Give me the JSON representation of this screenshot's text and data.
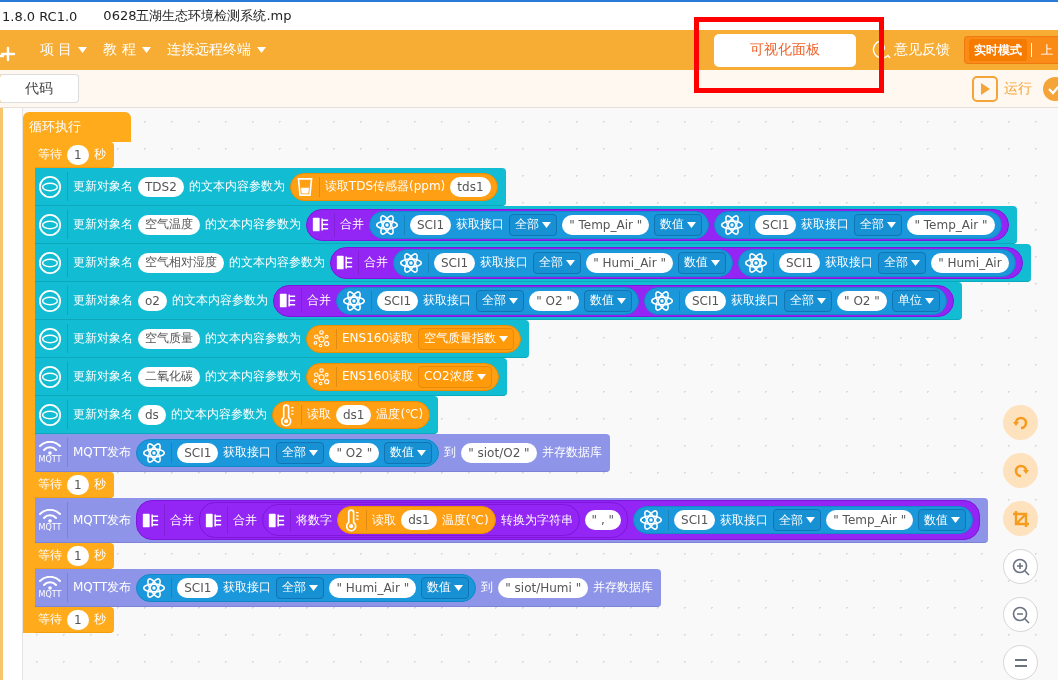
{
  "window": {
    "version": "1.8.0 RC1.0",
    "file": "0628五湖生态环境检测系统.mp"
  },
  "menu": [
    {
      "label": "项 目"
    },
    {
      "label": "教 程"
    },
    {
      "label": "连接远程终端"
    }
  ],
  "panel_button": "可视化面板",
  "feedback": "意见反馈",
  "mode_switch": [
    {
      "label": "实时模式",
      "selected": true
    },
    {
      "label": "上",
      "selected": false
    }
  ],
  "code_tab": "代码",
  "run_button": "运行",
  "program": {
    "hat": "循环执行",
    "statements": [
      {
        "kind": "wait",
        "parts": [
          {
            "kind": "text",
            "text": "等待"
          },
          {
            "kind": "field",
            "text": "1"
          },
          {
            "kind": "text",
            "text": "秒"
          }
        ]
      },
      {
        "kind": "update",
        "parts": [
          {
            "kind": "text",
            "text": "更新对象名"
          },
          {
            "kind": "field",
            "text": "TDS2"
          },
          {
            "kind": "text",
            "text": "的文本内容参数为"
          },
          {
            "kind": "tds",
            "parts": [
              {
                "kind": "text",
                "text": "读取TDS传感器(ppm)"
              },
              {
                "kind": "field",
                "text": "tds1"
              }
            ]
          }
        ]
      },
      {
        "kind": "update",
        "parts": [
          {
            "kind": "text",
            "text": "更新对象名"
          },
          {
            "kind": "field",
            "text": "空气温度"
          },
          {
            "kind": "text",
            "text": "的文本内容参数为"
          },
          {
            "kind": "string",
            "parts": [
              {
                "kind": "text",
                "text": "合并"
              },
              {
                "kind": "sci",
                "parts": [
                  {
                    "kind": "field",
                    "text": "SCI1"
                  },
                  {
                    "kind": "text",
                    "text": "获取接口"
                  },
                  {
                    "kind": "dropdown",
                    "text": "全部"
                  },
                  {
                    "kind": "field",
                    "text": "\" Temp_Air \""
                  },
                  {
                    "kind": "dropdown",
                    "text": "数值"
                  }
                ]
              },
              {
                "kind": "sci",
                "parts": [
                  {
                    "kind": "field",
                    "text": "SCI1"
                  },
                  {
                    "kind": "text",
                    "text": "获取接口"
                  },
                  {
                    "kind": "dropdown",
                    "text": "全部"
                  },
                  {
                    "kind": "field",
                    "text": "\" Temp_Air \""
                  }
                ]
              }
            ]
          }
        ]
      },
      {
        "kind": "update",
        "parts": [
          {
            "kind": "text",
            "text": "更新对象名"
          },
          {
            "kind": "field",
            "text": "空气相对湿度"
          },
          {
            "kind": "text",
            "text": "的文本内容参数为"
          },
          {
            "kind": "string",
            "parts": [
              {
                "kind": "text",
                "text": "合并"
              },
              {
                "kind": "sci",
                "parts": [
                  {
                    "kind": "field",
                    "text": "SCI1"
                  },
                  {
                    "kind": "text",
                    "text": "获取接口"
                  },
                  {
                    "kind": "dropdown",
                    "text": "全部"
                  },
                  {
                    "kind": "field",
                    "text": "\" Humi_Air \""
                  },
                  {
                    "kind": "dropdown",
                    "text": "数值"
                  }
                ]
              },
              {
                "kind": "sci",
                "parts": [
                  {
                    "kind": "field",
                    "text": "SCI1"
                  },
                  {
                    "kind": "text",
                    "text": "获取接口"
                  },
                  {
                    "kind": "dropdown",
                    "text": "全部"
                  },
                  {
                    "kind": "field",
                    "text": "\" Humi_Air"
                  }
                ]
              }
            ]
          }
        ]
      },
      {
        "kind": "update",
        "parts": [
          {
            "kind": "text",
            "text": "更新对象名"
          },
          {
            "kind": "field",
            "text": "o2"
          },
          {
            "kind": "text",
            "text": "的文本内容参数为"
          },
          {
            "kind": "string",
            "parts": [
              {
                "kind": "text",
                "text": "合并"
              },
              {
                "kind": "sci",
                "parts": [
                  {
                    "kind": "field",
                    "text": "SCI1"
                  },
                  {
                    "kind": "text",
                    "text": "获取接口"
                  },
                  {
                    "kind": "dropdown",
                    "text": "全部"
                  },
                  {
                    "kind": "field",
                    "text": "\" O2 \""
                  },
                  {
                    "kind": "dropdown",
                    "text": "数值"
                  }
                ]
              },
              {
                "kind": "sci",
                "parts": [
                  {
                    "kind": "field",
                    "text": "SCI1"
                  },
                  {
                    "kind": "text",
                    "text": "获取接口"
                  },
                  {
                    "kind": "dropdown",
                    "text": "全部"
                  },
                  {
                    "kind": "field",
                    "text": "\" O2 \""
                  },
                  {
                    "kind": "dropdown",
                    "text": "单位"
                  }
                ]
              }
            ]
          }
        ]
      },
      {
        "kind": "update",
        "parts": [
          {
            "kind": "text",
            "text": "更新对象名"
          },
          {
            "kind": "field",
            "text": "空气质量"
          },
          {
            "kind": "text",
            "text": "的文本内容参数为"
          },
          {
            "kind": "ens160",
            "parts": [
              {
                "kind": "text",
                "text": "ENS160读取"
              },
              {
                "kind": "dropdown",
                "text": "空气质量指数"
              }
            ]
          }
        ]
      },
      {
        "kind": "update",
        "parts": [
          {
            "kind": "text",
            "text": "更新对象名"
          },
          {
            "kind": "field",
            "text": "二氧化碳"
          },
          {
            "kind": "text",
            "text": "的文本内容参数为"
          },
          {
            "kind": "ens160",
            "parts": [
              {
                "kind": "text",
                "text": "ENS160读取"
              },
              {
                "kind": "dropdown",
                "text": "CO2浓度"
              }
            ]
          }
        ]
      },
      {
        "kind": "update",
        "parts": [
          {
            "kind": "text",
            "text": "更新对象名"
          },
          {
            "kind": "field",
            "text": "ds"
          },
          {
            "kind": "text",
            "text": "的文本内容参数为"
          },
          {
            "kind": "temperature",
            "parts": [
              {
                "kind": "text",
                "text": "读取"
              },
              {
                "kind": "field",
                "text": "ds1"
              },
              {
                "kind": "text",
                "text": "温度(℃)"
              }
            ]
          }
        ]
      },
      {
        "kind": "mqtt",
        "icon_label": "MQTT",
        "parts": [
          {
            "kind": "text",
            "text": "MQTT发布"
          },
          {
            "kind": "sci",
            "parts": [
              {
                "kind": "field",
                "text": "SCI1"
              },
              {
                "kind": "text",
                "text": "获取接口"
              },
              {
                "kind": "dropdown",
                "text": "全部"
              },
              {
                "kind": "field",
                "text": "\" O2 \""
              },
              {
                "kind": "dropdown",
                "text": "数值"
              }
            ]
          },
          {
            "kind": "text",
            "text": "到"
          },
          {
            "kind": "field",
            "text": "\" siot/O2 \""
          },
          {
            "kind": "text",
            "text": "并存数据库"
          }
        ]
      },
      {
        "kind": "wait",
        "parts": [
          {
            "kind": "text",
            "text": "等待"
          },
          {
            "kind": "field",
            "text": "1"
          },
          {
            "kind": "text",
            "text": "秒"
          }
        ]
      },
      {
        "kind": "mqtt",
        "icon_label": "MQTT",
        "parts": [
          {
            "kind": "text",
            "text": "MQTT发布"
          },
          {
            "kind": "string",
            "parts": [
              {
                "kind": "text",
                "text": "合并"
              },
              {
                "kind": "string",
                "parts": [
                  {
                    "kind": "text",
                    "text": "合并"
                  },
                  {
                    "kind": "string",
                    "parts": [
                      {
                        "kind": "text",
                        "text": "将数字"
                      },
                      {
                        "kind": "temperature",
                        "parts": [
                          {
                            "kind": "text",
                            "text": "读取"
                          },
                          {
                            "kind": "field",
                            "text": "ds1"
                          },
                          {
                            "kind": "text",
                            "text": "温度(℃)"
                          }
                        ]
                      },
                      {
                        "kind": "text",
                        "text": "转换为字符串"
                      }
                    ]
                  },
                  {
                    "kind": "field",
                    "text": "\" , \""
                  }
                ]
              },
              {
                "kind": "sci",
                "parts": [
                  {
                    "kind": "field",
                    "text": "SCI1"
                  },
                  {
                    "kind": "text",
                    "text": "获取接口"
                  },
                  {
                    "kind": "dropdown",
                    "text": "全部"
                  },
                  {
                    "kind": "field",
                    "text": "\" Temp_Air \""
                  },
                  {
                    "kind": "dropdown",
                    "text": "数值"
                  }
                ]
              }
            ]
          }
        ]
      },
      {
        "kind": "wait",
        "parts": [
          {
            "kind": "text",
            "text": "等待"
          },
          {
            "kind": "field",
            "text": "1"
          },
          {
            "kind": "text",
            "text": "秒"
          }
        ]
      },
      {
        "kind": "mqtt",
        "icon_label": "MQTT",
        "parts": [
          {
            "kind": "text",
            "text": "MQTT发布"
          },
          {
            "kind": "sci",
            "parts": [
              {
                "kind": "field",
                "text": "SCI1"
              },
              {
                "kind": "text",
                "text": "获取接口"
              },
              {
                "kind": "dropdown",
                "text": "全部"
              },
              {
                "kind": "field",
                "text": "\" Humi_Air \""
              },
              {
                "kind": "dropdown",
                "text": "数值"
              }
            ]
          },
          {
            "kind": "text",
            "text": "到"
          },
          {
            "kind": "field",
            "text": "\" siot/Humi \""
          },
          {
            "kind": "text",
            "text": "并存数据库"
          }
        ]
      },
      {
        "kind": "wait",
        "parts": [
          {
            "kind": "text",
            "text": "等待"
          },
          {
            "kind": "field",
            "text": "1"
          },
          {
            "kind": "text",
            "text": "秒"
          }
        ]
      }
    ]
  }
}
